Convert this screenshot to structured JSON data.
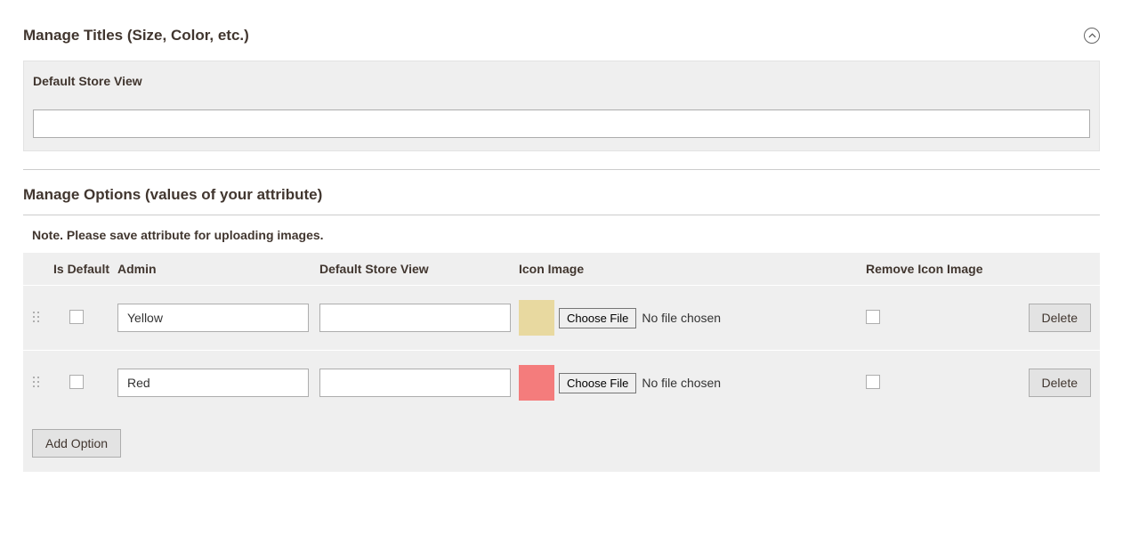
{
  "sections": {
    "titles": {
      "title": "Manage Titles (Size, Color, etc.)",
      "storeview_label": "Default Store View",
      "storeview_value": ""
    },
    "options": {
      "title": "Manage Options (values of your attribute)",
      "note": "Note. Please save attribute for uploading images.",
      "columns": {
        "is_default": "Is Default",
        "admin": "Admin",
        "storeview": "Default Store View",
        "icon": "Icon Image",
        "remove_icon": "Remove Icon Image"
      },
      "file_button_label": "Choose File",
      "file_none_label": "No file chosen",
      "delete_label": "Delete",
      "add_option_label": "Add Option",
      "rows": [
        {
          "admin": "Yellow",
          "storeview": "",
          "swatch_color": "#e8d9a0"
        },
        {
          "admin": "Red",
          "storeview": "",
          "swatch_color": "#f47c7c"
        }
      ]
    }
  }
}
